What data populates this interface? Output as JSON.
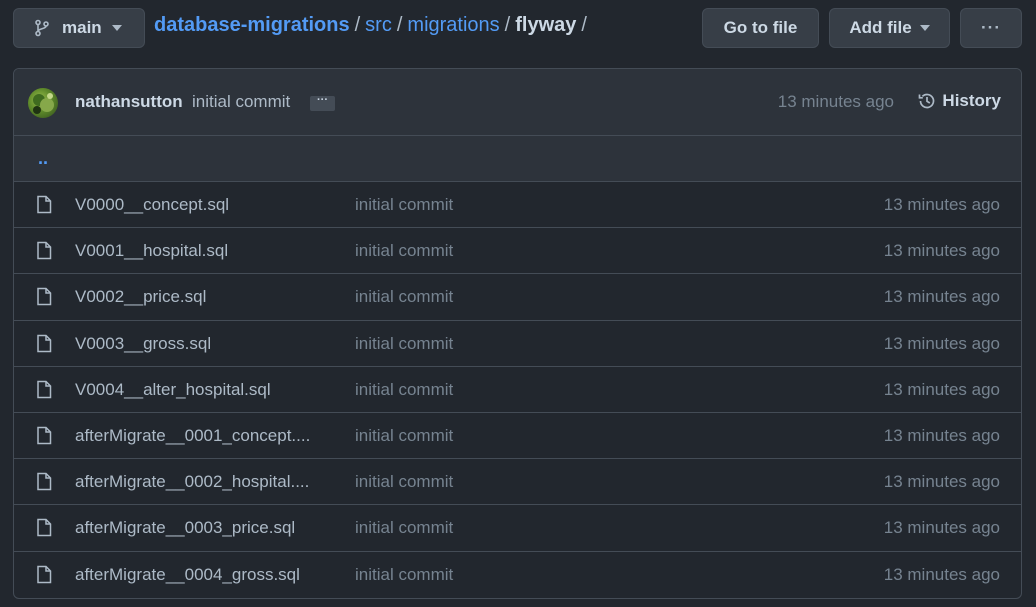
{
  "toolbar": {
    "branch": "main",
    "go_to_file": "Go to file",
    "add_file": "Add file",
    "more": "···"
  },
  "breadcrumb": {
    "repo": "database-migrations",
    "segments": [
      "src",
      "migrations"
    ],
    "current": "flyway",
    "separator": "/"
  },
  "latest_commit": {
    "author": "nathansutton",
    "message": "initial commit",
    "ellipsis": "···",
    "time": "13 minutes ago",
    "history_label": "History"
  },
  "parent_dir": "..",
  "files": [
    {
      "name": "V0000__concept.sql",
      "commit": "initial commit",
      "time": "13 minutes ago"
    },
    {
      "name": "V0001__hospital.sql",
      "commit": "initial commit",
      "time": "13 minutes ago"
    },
    {
      "name": "V0002__price.sql",
      "commit": "initial commit",
      "time": "13 minutes ago"
    },
    {
      "name": "V0003__gross.sql",
      "commit": "initial commit",
      "time": "13 minutes ago"
    },
    {
      "name": "V0004__alter_hospital.sql",
      "commit": "initial commit",
      "time": "13 minutes ago"
    },
    {
      "name": "afterMigrate__0001_concept....",
      "commit": "initial commit",
      "time": "13 minutes ago"
    },
    {
      "name": "afterMigrate__0002_hospital....",
      "commit": "initial commit",
      "time": "13 minutes ago"
    },
    {
      "name": "afterMigrate__0003_price.sql",
      "commit": "initial commit",
      "time": "13 minutes ago"
    },
    {
      "name": "afterMigrate__0004_gross.sql",
      "commit": "initial commit",
      "time": "13 minutes ago"
    }
  ],
  "colors": {
    "background": "#22272e",
    "link": "#539bf5",
    "muted": "#768390",
    "border": "#444c56"
  }
}
